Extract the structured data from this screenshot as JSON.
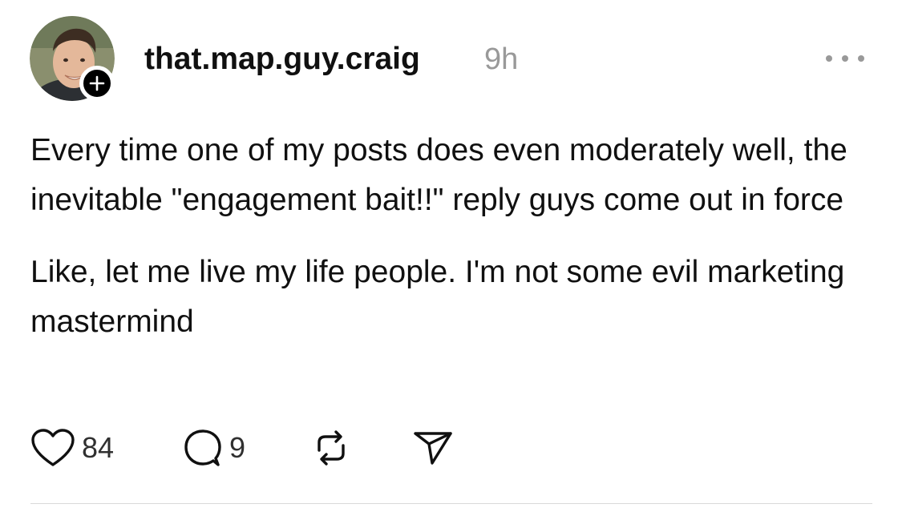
{
  "post": {
    "author": {
      "username": "that.map.guy.craig",
      "avatar_icon": "profile-photo",
      "follow_icon": "plus-icon"
    },
    "timestamp": "9h",
    "more_icon": "more-dots-icon",
    "paragraphs": [
      "Every time one of my posts does even moderately well, the inevitable \"engagement bait!!\" reply guys come out in force",
      "Like, let me live my life people. I'm not some evil marketing mastermind"
    ],
    "actions": {
      "likes": "84",
      "replies": "9",
      "like_icon": "heart-icon",
      "reply_icon": "speech-bubble-icon",
      "repost_icon": "repost-icon",
      "share_icon": "send-icon"
    }
  },
  "colors": {
    "text": "#101010",
    "muted": "#999999",
    "divider": "#d9d9d9"
  }
}
